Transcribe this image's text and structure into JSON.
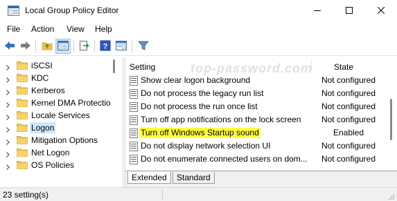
{
  "window": {
    "title": "Local Group Policy Editor"
  },
  "menu": [
    "File",
    "Action",
    "View",
    "Help"
  ],
  "tree": {
    "items": [
      {
        "label": "iSCSI",
        "selected": false
      },
      {
        "label": "KDC",
        "selected": false
      },
      {
        "label": "Kerberos",
        "selected": false
      },
      {
        "label": "Kernel DMA Protectio",
        "selected": false
      },
      {
        "label": "Locale Services",
        "selected": false
      },
      {
        "label": "Logon",
        "selected": true
      },
      {
        "label": "Mitigation Options",
        "selected": false
      },
      {
        "label": "Net Logon",
        "selected": false
      },
      {
        "label": "OS Policies",
        "selected": false
      }
    ]
  },
  "list": {
    "columns": {
      "setting": "Setting",
      "state": "State"
    },
    "watermark": "top-password.com",
    "rows": [
      {
        "setting": "Show clear logon background",
        "state": "Not configured",
        "highlight": false
      },
      {
        "setting": "Do not process the legacy run list",
        "state": "Not configured",
        "highlight": false
      },
      {
        "setting": "Do not process the run once list",
        "state": "Not configured",
        "highlight": false
      },
      {
        "setting": "Turn off app notifications on the lock screen",
        "state": "Not configured",
        "highlight": false
      },
      {
        "setting": "Turn off Windows Startup sound",
        "state": "Enabled",
        "highlight": true
      },
      {
        "setting": "Do not display network selection UI",
        "state": "Not configured",
        "highlight": false
      },
      {
        "setting": "Do not enumerate connected users on dom...",
        "state": "Not configured",
        "highlight": false
      }
    ]
  },
  "tabs": [
    "Extended",
    "Standard"
  ],
  "status": {
    "text": "23 setting(s)"
  },
  "colors": {
    "highlight": "#ffff3f",
    "selection": "#cce8ff",
    "folder": "#f0c24a"
  }
}
